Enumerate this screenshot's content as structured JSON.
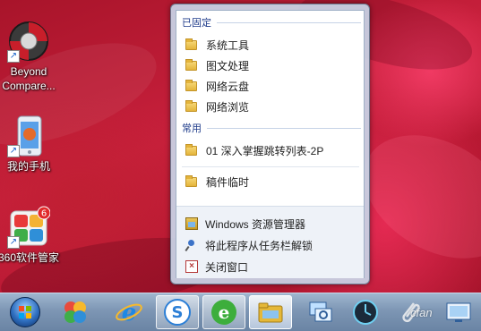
{
  "desktop": {
    "icons": [
      {
        "label": "Beyond Compare...",
        "icon": "beyond-compare-icon"
      },
      {
        "label": "我的手机",
        "icon": "phone-icon"
      },
      {
        "label": "360软件管家",
        "icon": "software-manager-icon",
        "badge": "6"
      }
    ]
  },
  "jumplist": {
    "pinned_header": "已固定",
    "pinned": [
      "系统工具",
      "图文处理",
      "网络云盘",
      "网络浏览"
    ],
    "frequent_header": "常用",
    "frequent": [
      "01 深入掌握跳转列表-2P",
      "稿件临时"
    ],
    "tasks": [
      {
        "label": "Windows 资源管理器",
        "icon": "explorer-icon"
      },
      {
        "label": "将此程序从任务栏解锁",
        "icon": "unpin-icon"
      },
      {
        "label": "关闭窗口",
        "icon": "close-window-icon"
      }
    ]
  },
  "taskbar": {
    "buttons": [
      "start",
      "color-app",
      "internet-explorer",
      "sogou-browser",
      "360-browser",
      "file-explorer",
      "network-tool",
      "clock-tool",
      "paperclip-tool",
      "display-tool"
    ]
  },
  "watermark": "cfan",
  "colors": {
    "accent": "#1e3b8a",
    "taskbar": "#7d96b4"
  }
}
